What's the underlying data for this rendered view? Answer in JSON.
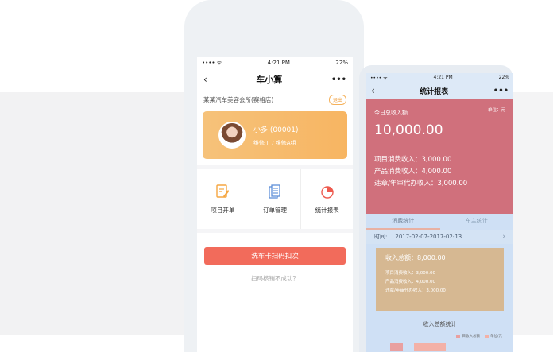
{
  "phone1": {
    "status": {
      "carrier": "•••• ᯤ",
      "time": "4:21 PM",
      "battery": "22%"
    },
    "nav": {
      "back": "‹",
      "title": "车小算",
      "more": "•••"
    },
    "shop": {
      "name": "某某汽车美容会所(赛格店)",
      "tag": "退出"
    },
    "user": {
      "name": "小多 (00001)",
      "role": "维修工 / 维修A组"
    },
    "menu": [
      {
        "label": "项目开单",
        "icon": "edit-icon"
      },
      {
        "label": "订单管理",
        "icon": "document-icon"
      },
      {
        "label": "统计报表",
        "icon": "pie-chart-icon"
      }
    ],
    "scan_button": "洗车卡扫码扣次",
    "fail_link": "扫码核销不成功？"
  },
  "phone2": {
    "status": {
      "carrier": "•••• ᯤ",
      "time": "4:21 PM",
      "battery": "22%"
    },
    "nav": {
      "back": "‹",
      "title": "统计报表",
      "more": "•••"
    },
    "unit": "单位：元",
    "total_label": "今日总收入额",
    "total_value": "10,000.00",
    "lines": [
      "项目消费收入：3,000.00",
      "产品消费收入：4,000.00",
      "违章/年审代办收入：3,000.00"
    ],
    "tabs": [
      "消费统计",
      "车主统计"
    ],
    "time_label": "时间:",
    "time_range": "2017-02-07-2017-02-13",
    "chevron": "›",
    "card_total": "收入总额：8,000.00",
    "card_lines": [
      "项目消费收入：3,000.00",
      "产品消费收入：4,000.00",
      "违章/年审代办收入：3,000.00"
    ],
    "chart_title": "收入总额统计",
    "legend": [
      "日收入总额",
      "单位/元"
    ]
  },
  "colors": {
    "accent_orange": "#f7b562",
    "button_red": "#f26b5b",
    "panel_red": "#d0707c",
    "panel_tan": "#d6b892"
  }
}
